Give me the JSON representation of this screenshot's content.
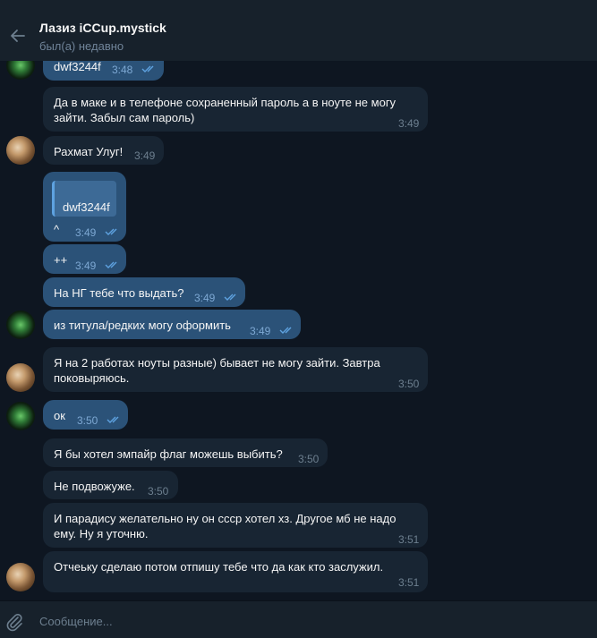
{
  "header": {
    "title": "Лазиз iCCup.mystick",
    "status": "был(а) недавно"
  },
  "messages": [
    {
      "text": "dwf3244f",
      "time": "3:48",
      "out": true
    },
    {
      "text": "Да в маке и в телефоне сохраненный пароль а в ноуте не могу зайти. Забыл сам пароль)",
      "time": "3:49",
      "out": false
    },
    {
      "text": "Рахмат Улуг!",
      "time": "3:49",
      "out": false
    },
    {
      "text": "^",
      "reply": "dwf3244f",
      "time": "3:49",
      "out": true
    },
    {
      "text": "++",
      "time": "3:49",
      "out": true
    },
    {
      "text": "На НГ тебе что выдать?",
      "time": "3:49",
      "out": true
    },
    {
      "text": "из титула/редких могу оформить",
      "time": "3:49",
      "out": true
    },
    {
      "text": "Я на 2 работах ноуты разные) бывает не могу зайти. Завтра поковыряюсь.",
      "time": "3:50",
      "out": false
    },
    {
      "text": "ок",
      "time": "3:50",
      "out": true
    },
    {
      "text": "Я бы хотел эмпайр флаг можешь выбить?",
      "time": "3:50",
      "out": false
    },
    {
      "text": "Не подвожуже.",
      "time": "3:50",
      "out": false
    },
    {
      "text": "И парадису желательно ну он ссср хотел хз. Другое мб не надо ему. Ну я уточню.",
      "time": "3:51",
      "out": false
    },
    {
      "text": "Отчеьку сделаю потом отпишу тебе что да как кто заслужил.",
      "time": "3:51",
      "out": false
    }
  ],
  "composer": {
    "placeholder": "Сообщение..."
  },
  "icons": {
    "back": "arrow-left-icon",
    "read": "double-check-icon",
    "attach": "paperclip-icon"
  },
  "colors": {
    "background": "#0e1621",
    "header": "#17212b",
    "incoming_bubble": "#182533",
    "outgoing_bubble": "#2b5278",
    "read_check": "#5ea2e0"
  }
}
